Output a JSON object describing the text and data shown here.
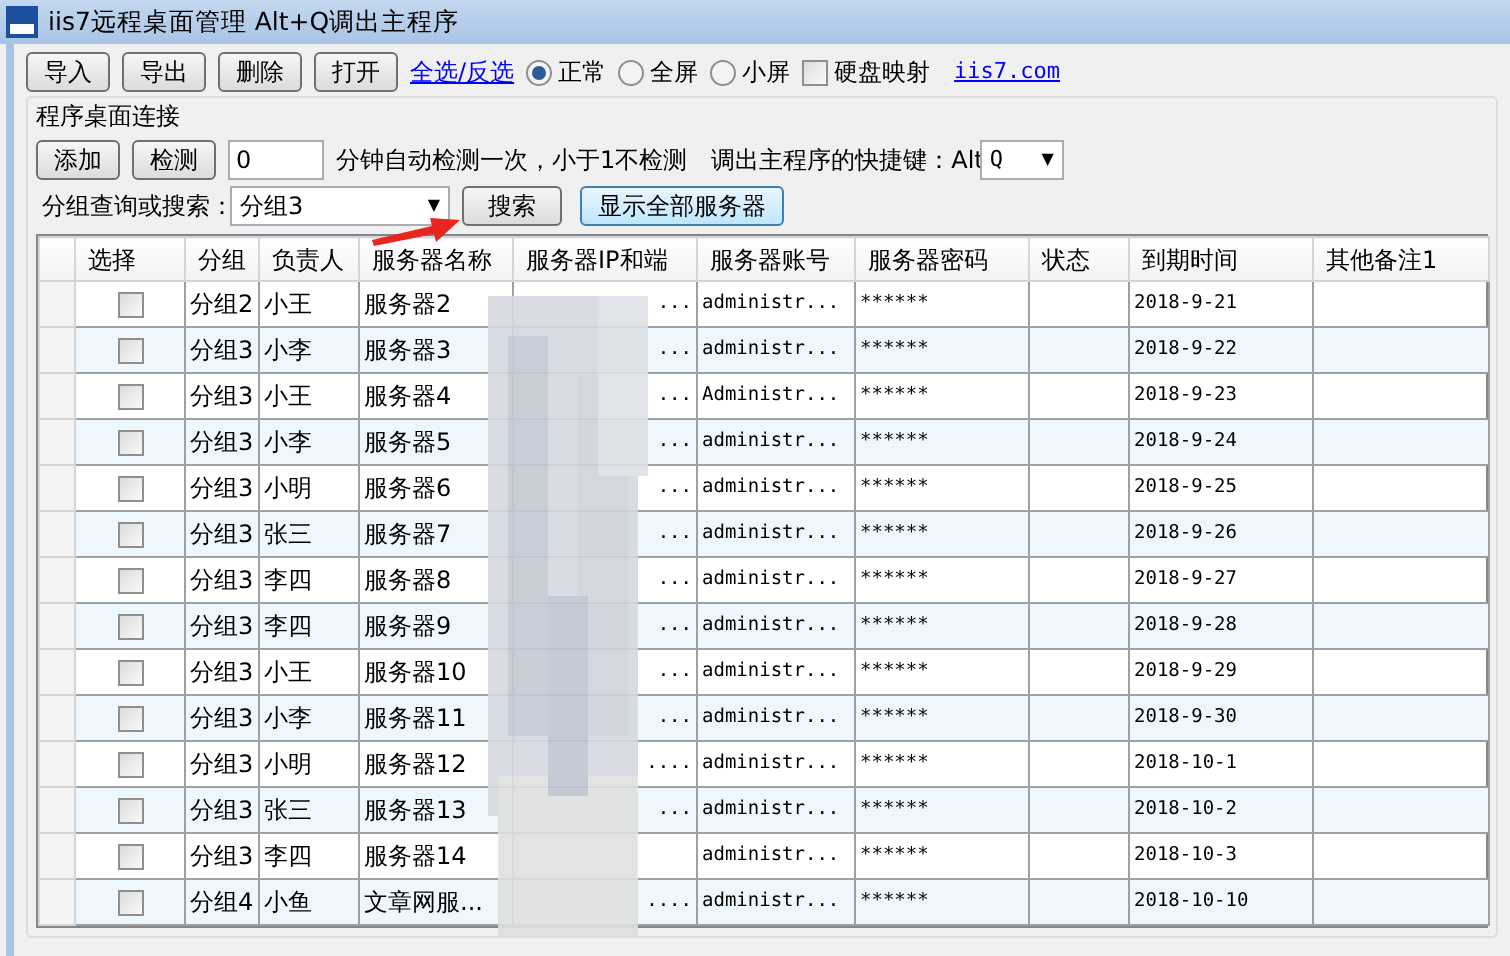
{
  "window": {
    "title": "iis7远程桌面管理 Alt+Q调出主程序"
  },
  "toolbar": {
    "buttons": [
      "导入",
      "导出",
      "删除",
      "打开"
    ],
    "link": "全选/反选",
    "radios": [
      {
        "label": "正常",
        "selected": true
      },
      {
        "label": "全屏",
        "selected": false
      },
      {
        "label": "小屏",
        "selected": false
      }
    ],
    "checkbox": {
      "label": "硬盘映射",
      "checked": false
    },
    "site_link": "iis7.com"
  },
  "group": {
    "title": "程序桌面连接",
    "buttons": [
      "添加",
      "检测"
    ],
    "interval": {
      "value": "0"
    },
    "interval_note": "分钟自动检测一次，小于1不检测",
    "hotkey_label": "调出主程序的快捷键：Alt",
    "hotkey": {
      "value": "Q",
      "caret": "▼"
    },
    "search_label": "分组查询或搜索：",
    "search": {
      "value": "分组3",
      "caret": "▼"
    },
    "search_button": "搜索",
    "show_all_button": "显示全部服务器"
  },
  "table": {
    "columns": [
      "选择",
      "分组",
      "负责人",
      "服务器名称",
      "服务器IP和端",
      "服务器账号",
      "服务器密码",
      "状态",
      "到期时间",
      "其他备注1"
    ],
    "rows": [
      {
        "checked": false,
        "group": "分组2",
        "owner": "小王",
        "name": "服务器2",
        "ip": "...",
        "account": "administr...",
        "password": "******",
        "status": "",
        "expires": "2018-9-21"
      },
      {
        "checked": false,
        "group": "分组3",
        "owner": "小李",
        "name": "服务器3",
        "ip": "...",
        "account": "administr...",
        "password": "******",
        "status": "",
        "expires": "2018-9-22"
      },
      {
        "checked": false,
        "group": "分组3",
        "owner": "小王",
        "name": "服务器4",
        "ip": "...",
        "account": "Administr...",
        "password": "******",
        "status": "",
        "expires": "2018-9-23"
      },
      {
        "checked": false,
        "group": "分组3",
        "owner": "小李",
        "name": "服务器5",
        "ip": "...",
        "account": "administr...",
        "password": "******",
        "status": "",
        "expires": "2018-9-24"
      },
      {
        "checked": false,
        "group": "分组3",
        "owner": "小明",
        "name": "服务器6",
        "ip": "...",
        "account": "administr...",
        "password": "******",
        "status": "",
        "expires": "2018-9-25"
      },
      {
        "checked": false,
        "group": "分组3",
        "owner": "张三",
        "name": "服务器7",
        "ip": "...",
        "account": "administr...",
        "password": "******",
        "status": "",
        "expires": "2018-9-26"
      },
      {
        "checked": false,
        "group": "分组3",
        "owner": "李四",
        "name": "服务器8",
        "ip": "...",
        "account": "administr...",
        "password": "******",
        "status": "",
        "expires": "2018-9-27"
      },
      {
        "checked": false,
        "group": "分组3",
        "owner": "李四",
        "name": "服务器9",
        "ip": "...",
        "account": "administr...",
        "password": "******",
        "status": "",
        "expires": "2018-9-28"
      },
      {
        "checked": false,
        "group": "分组3",
        "owner": "小王",
        "name": "服务器10",
        "ip": "...",
        "account": "administr...",
        "password": "******",
        "status": "",
        "expires": "2018-9-29"
      },
      {
        "checked": false,
        "group": "分组3",
        "owner": "小李",
        "name": "服务器11",
        "ip": "...",
        "account": "administr...",
        "password": "******",
        "status": "",
        "expires": "2018-9-30"
      },
      {
        "checked": false,
        "group": "分组3",
        "owner": "小明",
        "name": "服务器12",
        "ip": "....",
        "account": "administr...",
        "password": "******",
        "status": "",
        "expires": "2018-10-1"
      },
      {
        "checked": false,
        "group": "分组3",
        "owner": "张三",
        "name": "服务器13",
        "ip": "...",
        "account": "administr...",
        "password": "******",
        "status": "",
        "expires": "2018-10-2"
      },
      {
        "checked": false,
        "group": "分组3",
        "owner": "李四",
        "name": "服务器14",
        "ip": "",
        "account": "administr...",
        "password": "******",
        "status": "",
        "expires": "2018-10-3"
      },
      {
        "checked": false,
        "group": "分组4",
        "owner": "小鱼",
        "name": "文章网服...",
        "ip": "....",
        "account": "administr...",
        "password": "******",
        "status": "",
        "expires": "2018-10-10"
      }
    ]
  }
}
